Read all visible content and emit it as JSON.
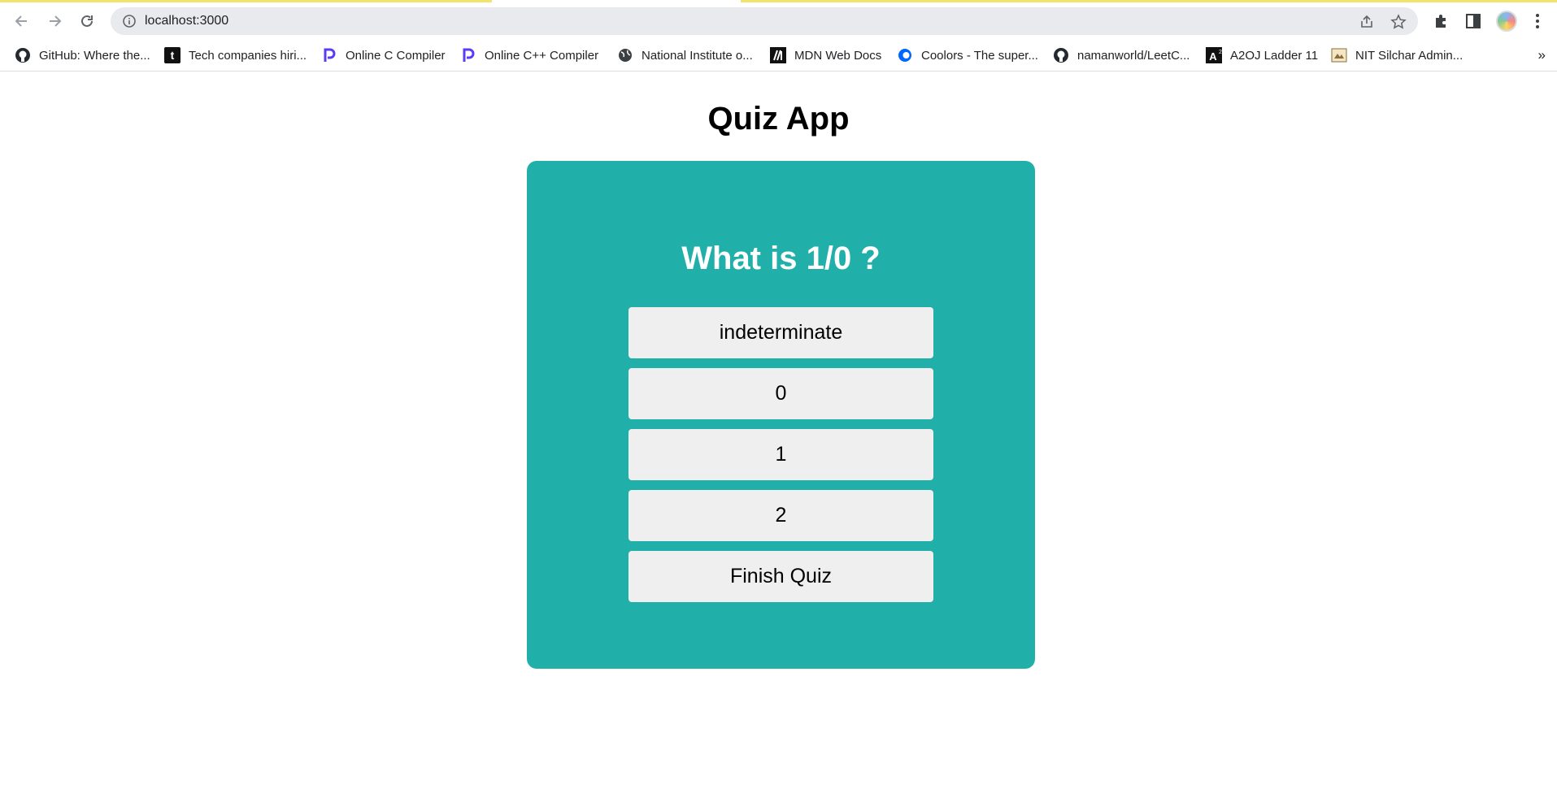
{
  "browser": {
    "url": "localhost:3000",
    "bookmarks": [
      {
        "label": "GitHub: Where the...",
        "icon": "github-icon"
      },
      {
        "label": "Tech companies hiri...",
        "icon": "t-logo-icon"
      },
      {
        "label": "Online C Compiler",
        "icon": "programiz-icon"
      },
      {
        "label": "Online C++ Compiler",
        "icon": "programiz-icon"
      },
      {
        "label": "National Institute o...",
        "icon": "globe-icon"
      },
      {
        "label": "MDN Web Docs",
        "icon": "mdn-icon"
      },
      {
        "label": "Coolors - The super...",
        "icon": "coolors-icon"
      },
      {
        "label": "namanworld/LeetC...",
        "icon": "github-icon"
      },
      {
        "label": "A2OJ Ladder 11",
        "icon": "a2oj-icon"
      },
      {
        "label": "NIT Silchar Admin...",
        "icon": "nit-icon"
      }
    ],
    "more_label": "»"
  },
  "app": {
    "title": "Quiz App",
    "question": "What is 1/0 ?",
    "options": [
      "indeterminate",
      "0",
      "1",
      "2"
    ],
    "finish_label": "Finish Quiz",
    "colors": {
      "card": "#20b0a9",
      "button": "#efefef"
    }
  }
}
